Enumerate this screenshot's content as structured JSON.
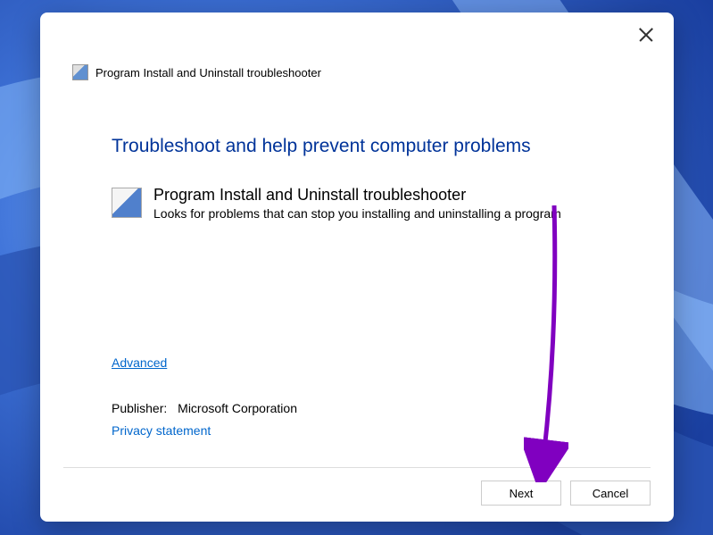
{
  "dialog": {
    "title": "Program Install and Uninstall troubleshooter",
    "heading": "Troubleshoot and help prevent computer problems",
    "item": {
      "title": "Program Install and Uninstall troubleshooter",
      "description": "Looks for problems that can stop you installing and uninstalling a program"
    },
    "advanced_link": "Advanced",
    "publisher_label": "Publisher:",
    "publisher_value": "Microsoft Corporation",
    "privacy_link": "Privacy statement",
    "buttons": {
      "next": "Next",
      "cancel": "Cancel"
    }
  }
}
